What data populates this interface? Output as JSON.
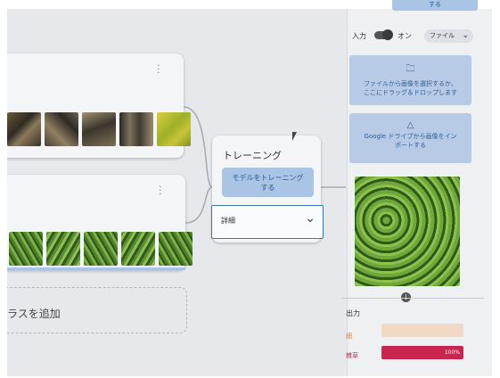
{
  "colors": {
    "accent": "#a9c4e4",
    "accent_text": "#2c5a92",
    "output_wood": "#f2d9c6",
    "output_grass": "#c8264e"
  },
  "class_cards": [
    {
      "menu_icon": "kebab-icon"
    },
    {
      "menu_icon": "kebab-icon"
    }
  ],
  "add_class": {
    "label": "ラスを追加"
  },
  "training": {
    "title": "トレーニング",
    "button": "モデルをトレーニング\nする",
    "details": "詳細"
  },
  "panel": {
    "top_button": "する",
    "input_label": "入力",
    "toggle_state": "オン",
    "source_select": "ファイル",
    "upload": {
      "icon": "folder-upload-icon",
      "text": "ファイルから画像を選択するか、\nここにドラッグ＆ドロップします"
    },
    "drive": {
      "icon": "google-drive-icon",
      "text": "Google ドライブから画像をイン\nポートする"
    },
    "output_title": "出力",
    "outputs": [
      {
        "label": "細",
        "percent": ""
      },
      {
        "label": "雑草",
        "percent": "100%"
      }
    ]
  }
}
